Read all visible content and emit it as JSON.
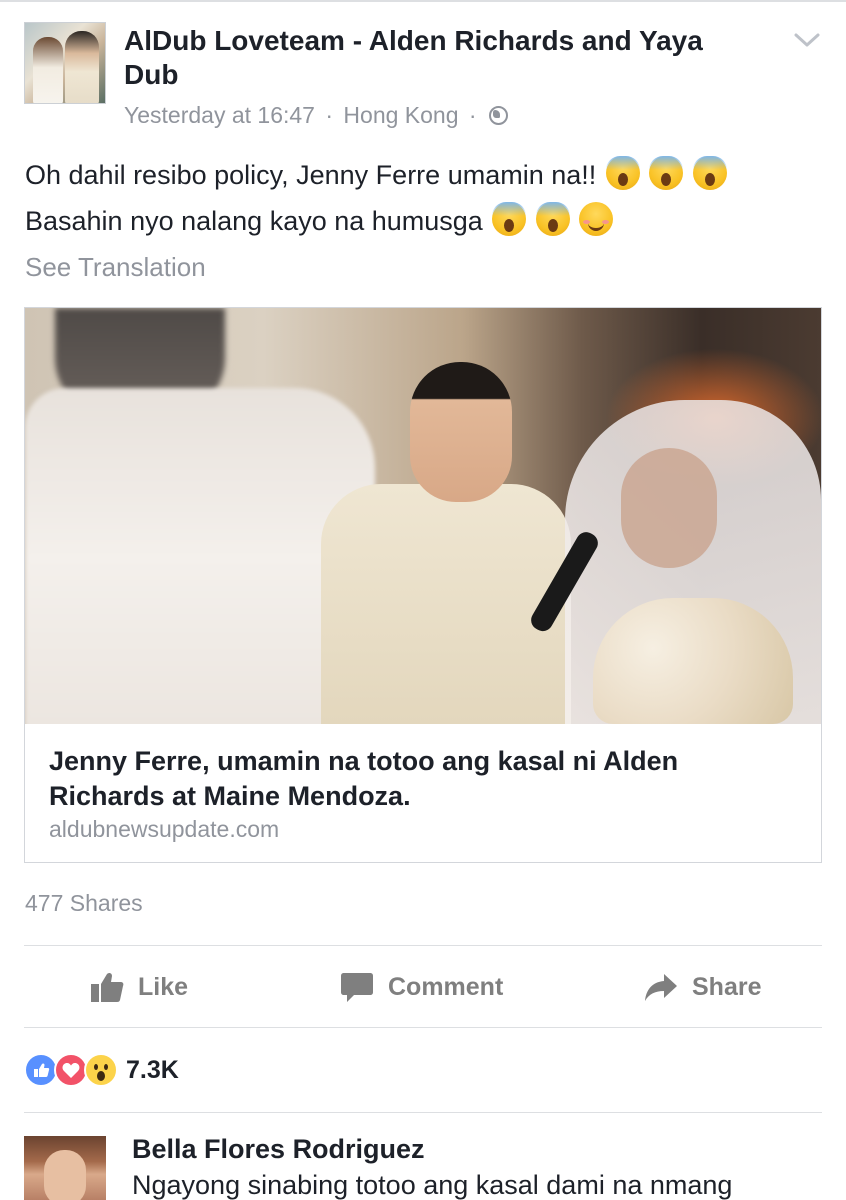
{
  "post": {
    "page_name": "AlDub Loveteam - Alden Richards and Yaya Dub",
    "timestamp": "Yesterday at 16:47",
    "location": "Hong Kong",
    "separator": "·",
    "privacy_icon": "globe-icon",
    "menu_icon": "chevron-down-icon",
    "text_line1": "Oh dahil resibo policy, Jenny Ferre umamin na!!",
    "text_line2": "Basahin nyo nalang kayo na humusga",
    "see_translation": "See Translation"
  },
  "link": {
    "title": "Jenny Ferre, umamin na totoo ang kasal ni Alden Richards at Maine Mendoza.",
    "domain": "aldubnewsupdate.com"
  },
  "stats": {
    "shares": "477 Shares",
    "reactions_count": "7.3K",
    "reaction_types": [
      "like",
      "love",
      "wow"
    ]
  },
  "actions": {
    "like": "Like",
    "comment": "Comment",
    "share": "Share"
  },
  "comment": {
    "author": "Bella Flores Rodriguez",
    "text": "Ngayong sinabing totoo ang kasal dami na nmang"
  },
  "colors": {
    "text": "#1d2129",
    "meta": "#90949c",
    "action": "#7f7f7f",
    "like_blue": "#5890ff",
    "love_red": "#f25268",
    "wow_yellow": "#fcd34a"
  }
}
